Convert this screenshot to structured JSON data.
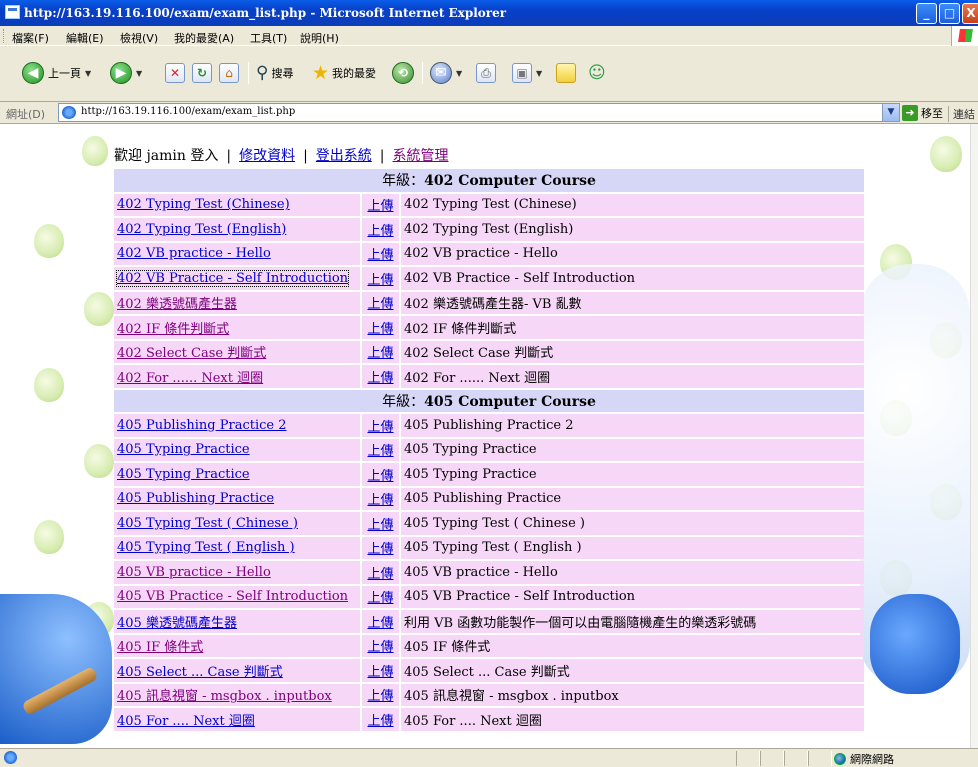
{
  "window": {
    "title": "http://163.19.116.100/exam/exam_list.php - Microsoft Internet Explorer",
    "min_glyph": "_",
    "max_glyph": "□",
    "close_glyph": "X"
  },
  "menubar": {
    "items": [
      "檔案(F)",
      "編輯(E)",
      "檢視(V)",
      "我的最愛(A)",
      "工具(T)",
      "說明(H)"
    ]
  },
  "toolbar": {
    "back_label": "上一頁",
    "search_label": "搜尋",
    "favorites_label": "我的最愛"
  },
  "addressbar": {
    "label": "網址(D)",
    "url": "http://163.19.116.100/exam/exam_list.php",
    "go_label": "移至",
    "links_label": "連結"
  },
  "welcome": {
    "greeting": "歡迎 jamin 登入",
    "sep": "|",
    "edit_profile": "修改資料",
    "logout": "登出系統",
    "admin": "系統管理"
  },
  "upload_label": "上傳",
  "sections": [
    {
      "heading_prefix": "年級：",
      "heading_course": "402 Computer Course",
      "rows": [
        {
          "link": "402 Typing Test (Chinese)",
          "desc": "402 Typing Test (Chinese)"
        },
        {
          "link": "402 Typing Test (English)",
          "desc": "402 Typing Test (English)"
        },
        {
          "link": "402 VB practice - Hello",
          "desc": "402 VB practice - Hello"
        },
        {
          "link": "402 VB Practice - Self Introduction",
          "desc": "402 VB Practice - Self Introduction"
        },
        {
          "link": "402 樂透號碼產生器",
          "desc": "402 樂透號碼產生器- VB 亂數"
        },
        {
          "link": "402 IF 條件判斷式",
          "desc": "402 IF 條件判斷式"
        },
        {
          "link": "402 Select Case 判斷式",
          "desc": "402 Select Case 判斷式"
        },
        {
          "link": "402 For ...... Next 迴圈",
          "desc": "402 For ...... Next 迴圈"
        }
      ]
    },
    {
      "heading_prefix": "年級：",
      "heading_course": "405 Computer Course",
      "rows": [
        {
          "link": "405 Publishing Practice 2",
          "desc": "405 Publishing Practice 2"
        },
        {
          "link": "405 Typing Practice",
          "desc": "405 Typing Practice"
        },
        {
          "link": "405 Typing Practice",
          "desc": "405 Typing Practice"
        },
        {
          "link": "405 Publishing Practice",
          "desc": "405 Publishing Practice"
        },
        {
          "link": "405 Typing Test ( Chinese )",
          "desc": "405 Typing Test ( Chinese )"
        },
        {
          "link": "405 Typing Test ( English )",
          "desc": "405 Typing Test ( English )"
        },
        {
          "link": "405 VB practice - Hello",
          "desc": "405 VB practice - Hello"
        },
        {
          "link": "405 VB Practice - Self Introduction",
          "desc": "405 VB Practice - Self Introduction"
        },
        {
          "link": "405 樂透號碼產生器",
          "desc": "利用 VB 函數功能製作一個可以由電腦隨機產生的樂透彩號碼"
        },
        {
          "link": "405 IF 條件式",
          "desc": "405 IF 條件式"
        },
        {
          "link": "405 Select ... Case 判斷式",
          "desc": "405 Select ... Case 判斷式"
        },
        {
          "link": "405 訊息視窗 - msgbox . inputbox",
          "desc": "405 訊息視窗 - msgbox . inputbox"
        },
        {
          "link": "405 For .... Next 迴圈",
          "desc": "405 For .... Next 迴圈"
        }
      ]
    }
  ],
  "statusbar": {
    "zone": "網際網路"
  },
  "colors": {
    "header_row": "#d6d7f7",
    "data_row": "#f7d7f7",
    "link": "#0000cc",
    "visited_link": "#800080"
  }
}
